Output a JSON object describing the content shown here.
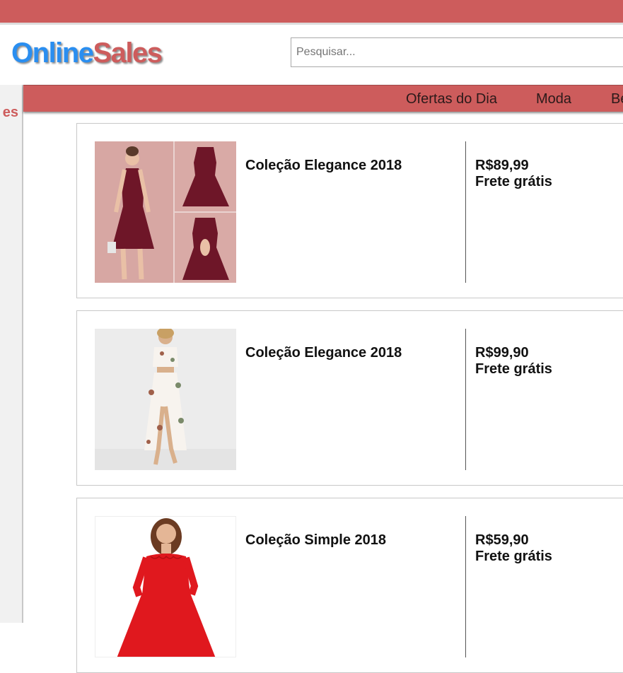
{
  "brand": {
    "part1": "Online",
    "part2": "Sales"
  },
  "search": {
    "placeholder": "Pesquisar..."
  },
  "sidebar": {
    "label": "es"
  },
  "nav": {
    "items": [
      "Ofertas do Dia",
      "Moda",
      "Be"
    ]
  },
  "products": [
    {
      "title": "Coleção Elegance 2018",
      "price": "R$89,99",
      "shipping": "Frete grátis",
      "image": "burgundy-halter-dress-photo"
    },
    {
      "title": "Coleção Elegance 2018",
      "price": "R$99,90",
      "shipping": "Frete grátis",
      "image": "white-floral-two-piece-photo"
    },
    {
      "title": "Coleção Simple 2018",
      "price": "R$59,90",
      "shipping": "Frete grátis",
      "image": "red-scalloped-dress-photo"
    }
  ],
  "colors": {
    "accent": "#cd5c5c",
    "logo_blue": "#2a8ef0"
  }
}
